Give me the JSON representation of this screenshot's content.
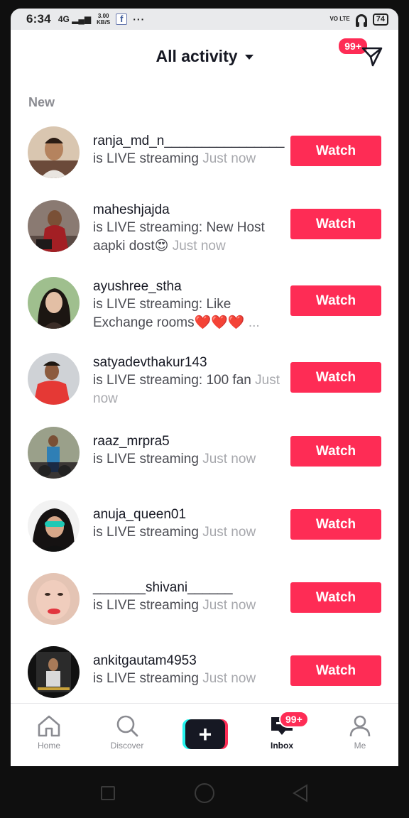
{
  "status_bar": {
    "time": "6:34",
    "network": "4G",
    "speed_value": "3.00",
    "speed_unit": "KB/S",
    "facebook_glyph": "f",
    "more": "···",
    "volte": "VO LTE",
    "battery": "74"
  },
  "header": {
    "title": "All activity",
    "badge": "99+"
  },
  "section_label": "New",
  "activities": [
    {
      "username": "ranja_md_n________________",
      "text": "is LIVE streaming",
      "time": "Just now",
      "button": "Watch"
    },
    {
      "username": "maheshjajda",
      "text": "is LIVE streaming: New Host aapki dost😍",
      "time": "Just now",
      "button": "Watch"
    },
    {
      "username": "ayushree_stha",
      "text": "is LIVE streaming: Like Exchange rooms❤️❤️❤️",
      "time": "...",
      "button": "Watch"
    },
    {
      "username": "satyadevthakur143",
      "text": "is LIVE streaming: 100 fan",
      "time": "Just now",
      "button": "Watch"
    },
    {
      "username": "raaz_mrpra5",
      "text": "is LIVE streaming",
      "time": "Just now",
      "button": "Watch"
    },
    {
      "username": "anuja_queen01",
      "text": "is LIVE streaming",
      "time": "Just now",
      "button": "Watch"
    },
    {
      "username": "_______shivani______",
      "text": "is LIVE streaming",
      "time": "Just now",
      "button": "Watch"
    },
    {
      "username": "ankitgautam4953",
      "text": "is LIVE streaming",
      "time": "Just now",
      "button": "Watch"
    }
  ],
  "nav": {
    "home": "Home",
    "discover": "Discover",
    "create": "+",
    "inbox": "Inbox",
    "inbox_badge": "99+",
    "me": "Me"
  },
  "colors": {
    "accent": "#fe2c55",
    "cyan": "#25f4ee",
    "text": "#161823"
  },
  "icons": {
    "send": "send-icon",
    "home": "home-icon",
    "discover": "search-icon",
    "inbox": "inbox-icon",
    "me": "profile-icon"
  }
}
